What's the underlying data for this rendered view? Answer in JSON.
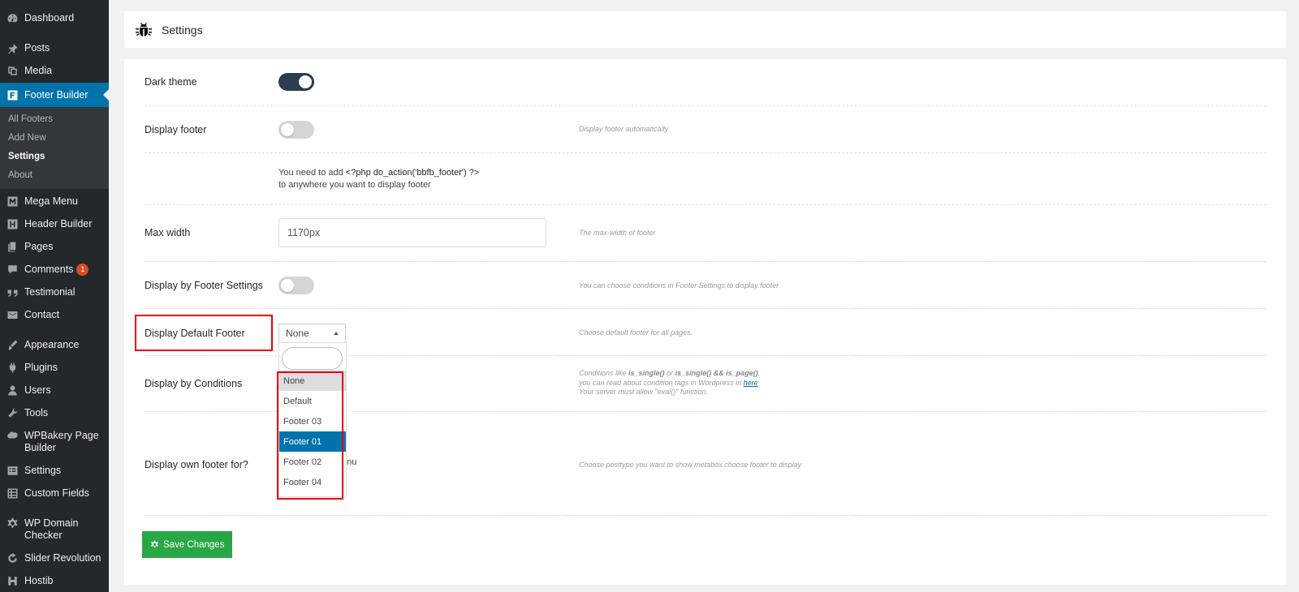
{
  "sidebar": {
    "items": [
      {
        "label": "Dashboard",
        "icon": "dashboard-icon"
      },
      {
        "label": "Posts",
        "icon": "pin-icon"
      },
      {
        "label": "Media",
        "icon": "media-icon"
      },
      {
        "label": "Footer Builder",
        "icon": "footer-builder-icon"
      },
      {
        "label": "Mega Menu",
        "icon": "mega-menu-icon"
      },
      {
        "label": "Header Builder",
        "icon": "header-builder-icon"
      },
      {
        "label": "Pages",
        "icon": "pages-icon"
      },
      {
        "label": "Comments",
        "icon": "comments-icon",
        "badge": "1"
      },
      {
        "label": "Testimonial",
        "icon": "quote-icon"
      },
      {
        "label": "Contact",
        "icon": "mail-icon"
      },
      {
        "label": "Appearance",
        "icon": "brush-icon"
      },
      {
        "label": "Plugins",
        "icon": "plug-icon"
      },
      {
        "label": "Users",
        "icon": "user-icon"
      },
      {
        "label": "Tools",
        "icon": "wrench-icon"
      },
      {
        "label": "WPBakery Page Builder",
        "icon": "wpbakery-icon"
      },
      {
        "label": "Settings",
        "icon": "settings-icon"
      },
      {
        "label": "Custom Fields",
        "icon": "grid-icon"
      },
      {
        "label": "WP Domain Checker",
        "icon": "gear-icon"
      },
      {
        "label": "Slider Revolution",
        "icon": "refresh-icon"
      },
      {
        "label": "Hostib",
        "icon": "hostib-icon"
      }
    ],
    "submenu": [
      "All Footers",
      "Add New",
      "Settings",
      "About"
    ]
  },
  "header": {
    "title": "Settings",
    "icon": "bug-icon"
  },
  "settings": {
    "dark_theme": {
      "label": "Dark theme",
      "on": true
    },
    "display_footer": {
      "label": "Display footer",
      "on": false,
      "desc": "Display footer automatically"
    },
    "php_note": {
      "line1_prefix": "You need to add ",
      "code": "<?php do_action('bbfb_footer') ?>",
      "line2": "to anywhere you want to display footer"
    },
    "max_width": {
      "label": "Max width",
      "value": "1170px",
      "desc": "The max-width of footer"
    },
    "display_by_footer_settings": {
      "label": "Display by Footer Settings",
      "on": false,
      "desc": "You can choose conditions in Footer Settings to display footer"
    },
    "display_default_footer": {
      "label": "Display Default Footer",
      "value": "None",
      "desc": "Choose default footer for all pages."
    },
    "display_by_conditions": {
      "label": "Display by Conditions",
      "desc_line1_a": "Conditions like ",
      "desc_line1_b": "is_single()",
      "desc_line1_c": " or ",
      "desc_line1_d": "is_single() && is_page()",
      "desc_line1_e": ",",
      "desc_line2_a": "you can read about condition tags in Wordpress in ",
      "desc_line2_link": "here",
      "desc_line3": "Your server must allow \"eval()\" function."
    },
    "display_own_footer": {
      "label": "Display own footer for?",
      "partial_text": "enu",
      "desc": "Choose posttype you want to show metabox choose footer to display"
    }
  },
  "dropdown": {
    "options": [
      "None",
      "Default",
      "Footer 03",
      "Footer 01",
      "Footer 02",
      "Footer 04"
    ],
    "highlighted": "Footer 01",
    "dimmed": "None"
  },
  "save_label": "Save Changes",
  "colors": {
    "sidebar_bg": "#23282d",
    "active": "#0073aa",
    "toggle_on": "#2c3e50",
    "save": "#28a745",
    "highlight": "#ee0000"
  }
}
